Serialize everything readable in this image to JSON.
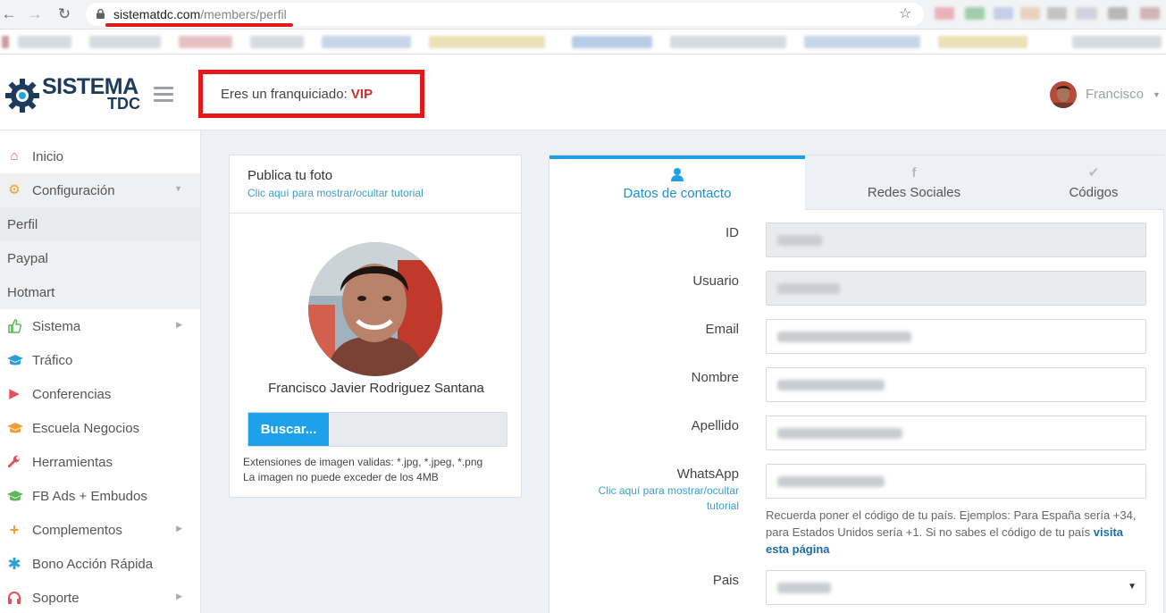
{
  "browser": {
    "url_domain": "sistematdc.com",
    "url_path": "/members/perfil"
  },
  "header": {
    "logo_title": "SISTEMA",
    "logo_sub": "TDC",
    "franchise_prefix": "Eres un franquiciado: ",
    "franchise_level": "VIP",
    "user_name": "Francisco",
    "colors": {
      "brand": "#1e3b5c",
      "accent": "#1da1e8",
      "highlight": "#e3191b"
    }
  },
  "sidebar": {
    "items": [
      {
        "label": "Inicio",
        "icon": "home-icon"
      },
      {
        "label": "Configuración",
        "icon": "gear-icon"
      },
      {
        "label": "Perfil"
      },
      {
        "label": "Paypal"
      },
      {
        "label": "Hotmart"
      },
      {
        "label": "Sistema",
        "icon": "thumbs-up-icon"
      },
      {
        "label": "Tráfico",
        "icon": "graduation-cap-icon"
      },
      {
        "label": "Conferencias",
        "icon": "play-icon"
      },
      {
        "label": "Escuela Negocios",
        "icon": "graduation-cap-icon"
      },
      {
        "label": "Herramientas",
        "icon": "wrench-icon"
      },
      {
        "label": "FB Ads + Embudos",
        "icon": "graduation-cap-icon"
      },
      {
        "label": "Complementos",
        "icon": "plus-icon"
      },
      {
        "label": "Bono Acción Rápida",
        "icon": "asterisk-icon"
      },
      {
        "label": "Soporte",
        "icon": "headphones-icon"
      }
    ]
  },
  "photo_card": {
    "title": "Publica tu foto",
    "tutorial_link": "Clic aquí para mostrar/ocultar tutorial",
    "profile_name": "Francisco Javier Rodriguez Santana",
    "browse_label": "Buscar...",
    "help_line1": "Extensiones de imagen validas: *.jpg, *.jpeg, *.png",
    "help_line2": "La imagen no puede exceder de los 4MB"
  },
  "contact_card": {
    "tabs": [
      {
        "label": "Datos de contacto",
        "icon": "user-icon"
      },
      {
        "label": "Redes Sociales",
        "icon": "facebook-icon"
      },
      {
        "label": "Códigos",
        "icon": "check-icon"
      }
    ],
    "fields": {
      "id": "ID",
      "usuario": "Usuario",
      "email": "Email",
      "nombre": "Nombre",
      "apellido": "Apellido",
      "whatsapp": "WhatsApp",
      "pais": "Pais"
    },
    "whatsapp_tutorial": "Clic aquí para mostrar/ocultar tutorial",
    "whatsapp_help": "Recuerda poner el código de tu país. Ejemplos: Para España sería +34, para Estados Unidos sería +1. Si no sabes el código de tu país ",
    "whatsapp_link": "visita esta página"
  }
}
